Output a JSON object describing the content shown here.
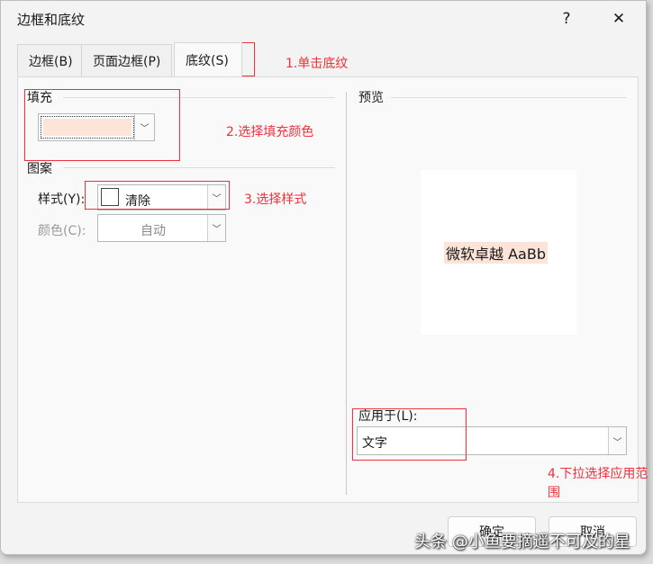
{
  "window": {
    "title": "边框和底纹",
    "help": "?",
    "close": "✕"
  },
  "tabs": [
    {
      "label": "边框(B)"
    },
    {
      "label": "页面边框(P)"
    },
    {
      "label": "底纹(S)"
    }
  ],
  "fill": {
    "label": "填充",
    "color": "#fde4d8"
  },
  "pattern": {
    "label": "图案",
    "style_label": "样式(Y):",
    "style_value": "清除",
    "color_label": "颜色(C):",
    "color_value": "自动"
  },
  "preview": {
    "label": "预览",
    "sample": "微软卓越  AaBb"
  },
  "apply": {
    "label": "应用于(L):",
    "value": "文字"
  },
  "buttons": {
    "ok": "确定",
    "cancel": "取消"
  },
  "annotations": [
    "1.单击底纹",
    "2.选择填充颜色",
    "3.选择样式",
    "4.下拉选择应用范围"
  ],
  "watermark": "头条 @小鱼要摘遥不可及的星",
  "colors": {
    "annotation": "#f0303a"
  }
}
